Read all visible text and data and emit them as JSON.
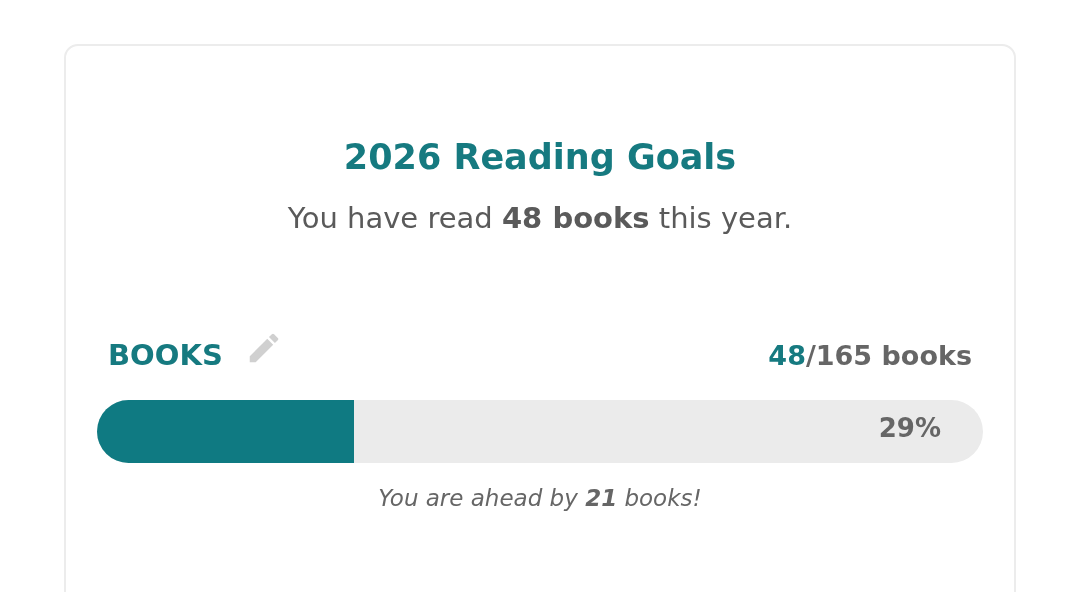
{
  "card": {
    "title": "2026 Reading Goals",
    "summary": "You have read **48 books** this year."
  },
  "goal": {
    "label": "BOOKS",
    "current": "48",
    "total": "/165 books",
    "level": 0.29,
    "percent": "29%",
    "note": "You are ahead by **21** books!"
  }
}
